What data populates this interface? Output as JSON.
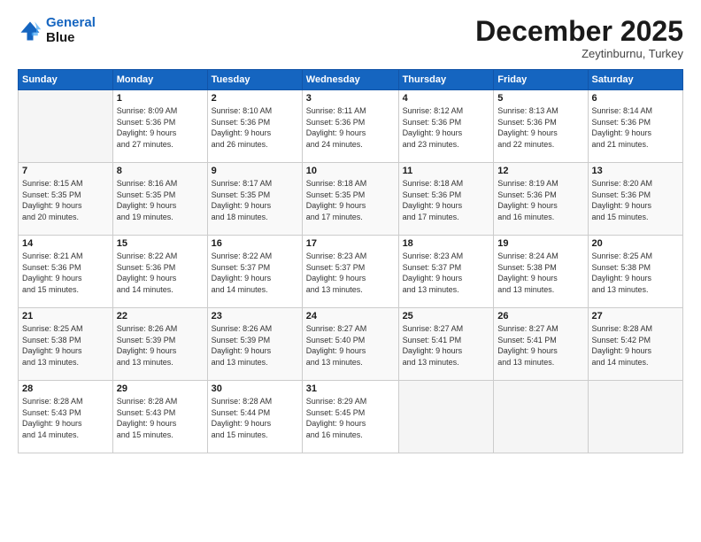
{
  "header": {
    "logo_line1": "General",
    "logo_line2": "Blue",
    "month": "December 2025",
    "location": "Zeytinburnu, Turkey"
  },
  "days_of_week": [
    "Sunday",
    "Monday",
    "Tuesday",
    "Wednesday",
    "Thursday",
    "Friday",
    "Saturday"
  ],
  "weeks": [
    [
      {
        "day": "",
        "info": ""
      },
      {
        "day": "1",
        "info": "Sunrise: 8:09 AM\nSunset: 5:36 PM\nDaylight: 9 hours\nand 27 minutes."
      },
      {
        "day": "2",
        "info": "Sunrise: 8:10 AM\nSunset: 5:36 PM\nDaylight: 9 hours\nand 26 minutes."
      },
      {
        "day": "3",
        "info": "Sunrise: 8:11 AM\nSunset: 5:36 PM\nDaylight: 9 hours\nand 24 minutes."
      },
      {
        "day": "4",
        "info": "Sunrise: 8:12 AM\nSunset: 5:36 PM\nDaylight: 9 hours\nand 23 minutes."
      },
      {
        "day": "5",
        "info": "Sunrise: 8:13 AM\nSunset: 5:36 PM\nDaylight: 9 hours\nand 22 minutes."
      },
      {
        "day": "6",
        "info": "Sunrise: 8:14 AM\nSunset: 5:36 PM\nDaylight: 9 hours\nand 21 minutes."
      }
    ],
    [
      {
        "day": "7",
        "info": "Sunrise: 8:15 AM\nSunset: 5:35 PM\nDaylight: 9 hours\nand 20 minutes."
      },
      {
        "day": "8",
        "info": "Sunrise: 8:16 AM\nSunset: 5:35 PM\nDaylight: 9 hours\nand 19 minutes."
      },
      {
        "day": "9",
        "info": "Sunrise: 8:17 AM\nSunset: 5:35 PM\nDaylight: 9 hours\nand 18 minutes."
      },
      {
        "day": "10",
        "info": "Sunrise: 8:18 AM\nSunset: 5:35 PM\nDaylight: 9 hours\nand 17 minutes."
      },
      {
        "day": "11",
        "info": "Sunrise: 8:18 AM\nSunset: 5:36 PM\nDaylight: 9 hours\nand 17 minutes."
      },
      {
        "day": "12",
        "info": "Sunrise: 8:19 AM\nSunset: 5:36 PM\nDaylight: 9 hours\nand 16 minutes."
      },
      {
        "day": "13",
        "info": "Sunrise: 8:20 AM\nSunset: 5:36 PM\nDaylight: 9 hours\nand 15 minutes."
      }
    ],
    [
      {
        "day": "14",
        "info": "Sunrise: 8:21 AM\nSunset: 5:36 PM\nDaylight: 9 hours\nand 15 minutes."
      },
      {
        "day": "15",
        "info": "Sunrise: 8:22 AM\nSunset: 5:36 PM\nDaylight: 9 hours\nand 14 minutes."
      },
      {
        "day": "16",
        "info": "Sunrise: 8:22 AM\nSunset: 5:37 PM\nDaylight: 9 hours\nand 14 minutes."
      },
      {
        "day": "17",
        "info": "Sunrise: 8:23 AM\nSunset: 5:37 PM\nDaylight: 9 hours\nand 13 minutes."
      },
      {
        "day": "18",
        "info": "Sunrise: 8:23 AM\nSunset: 5:37 PM\nDaylight: 9 hours\nand 13 minutes."
      },
      {
        "day": "19",
        "info": "Sunrise: 8:24 AM\nSunset: 5:38 PM\nDaylight: 9 hours\nand 13 minutes."
      },
      {
        "day": "20",
        "info": "Sunrise: 8:25 AM\nSunset: 5:38 PM\nDaylight: 9 hours\nand 13 minutes."
      }
    ],
    [
      {
        "day": "21",
        "info": "Sunrise: 8:25 AM\nSunset: 5:38 PM\nDaylight: 9 hours\nand 13 minutes."
      },
      {
        "day": "22",
        "info": "Sunrise: 8:26 AM\nSunset: 5:39 PM\nDaylight: 9 hours\nand 13 minutes."
      },
      {
        "day": "23",
        "info": "Sunrise: 8:26 AM\nSunset: 5:39 PM\nDaylight: 9 hours\nand 13 minutes."
      },
      {
        "day": "24",
        "info": "Sunrise: 8:27 AM\nSunset: 5:40 PM\nDaylight: 9 hours\nand 13 minutes."
      },
      {
        "day": "25",
        "info": "Sunrise: 8:27 AM\nSunset: 5:41 PM\nDaylight: 9 hours\nand 13 minutes."
      },
      {
        "day": "26",
        "info": "Sunrise: 8:27 AM\nSunset: 5:41 PM\nDaylight: 9 hours\nand 13 minutes."
      },
      {
        "day": "27",
        "info": "Sunrise: 8:28 AM\nSunset: 5:42 PM\nDaylight: 9 hours\nand 14 minutes."
      }
    ],
    [
      {
        "day": "28",
        "info": "Sunrise: 8:28 AM\nSunset: 5:43 PM\nDaylight: 9 hours\nand 14 minutes."
      },
      {
        "day": "29",
        "info": "Sunrise: 8:28 AM\nSunset: 5:43 PM\nDaylight: 9 hours\nand 15 minutes."
      },
      {
        "day": "30",
        "info": "Sunrise: 8:28 AM\nSunset: 5:44 PM\nDaylight: 9 hours\nand 15 minutes."
      },
      {
        "day": "31",
        "info": "Sunrise: 8:29 AM\nSunset: 5:45 PM\nDaylight: 9 hours\nand 16 minutes."
      },
      {
        "day": "",
        "info": ""
      },
      {
        "day": "",
        "info": ""
      },
      {
        "day": "",
        "info": ""
      }
    ]
  ]
}
